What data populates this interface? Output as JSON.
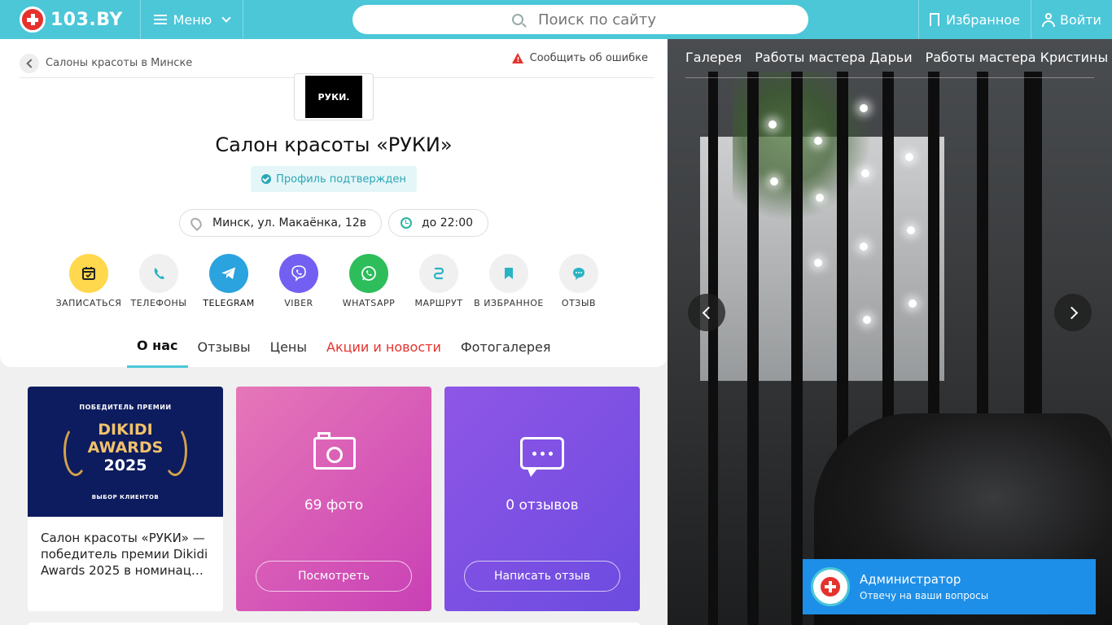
{
  "header": {
    "logo_text": "103.BY",
    "menu_label": "Меню",
    "search_placeholder": "Поиск по сайту",
    "favorites_label": "Избранное",
    "login_label": "Войти"
  },
  "breadcrumb": {
    "label": "Салоны красоты в Минске"
  },
  "report_label": "Сообщить об ошибке",
  "salon": {
    "logo_text": "РУКИ.",
    "title": "Салон красоты «РУКИ»",
    "verified": "Профиль подтвержден",
    "address": "Минск, ул. Макаёнка, 12в",
    "hours": "до 22:00"
  },
  "actions": [
    {
      "label": "ЗАПИСАТЬСЯ",
      "icon": "calendar-icon",
      "color": "#ffd84d"
    },
    {
      "label": "ТЕЛЕФОНЫ",
      "icon": "phone-icon",
      "color": "#f0f0f0"
    },
    {
      "label": "TELEGRAM",
      "icon": "telegram-icon",
      "color": "#2aa3df"
    },
    {
      "label": "VIBER",
      "icon": "viber-icon",
      "color": "#7360f2"
    },
    {
      "label": "WHATSAPP",
      "icon": "whatsapp-icon",
      "color": "#2dbd5b"
    },
    {
      "label": "МАРШРУТ",
      "icon": "route-icon",
      "color": "#f0f0f0"
    },
    {
      "label": "В ИЗБРАННОЕ",
      "icon": "bookmark-icon",
      "color": "#f0f0f0"
    },
    {
      "label": "ОТЗЫВ",
      "icon": "review-icon",
      "color": "#f0f0f0"
    }
  ],
  "tabs": [
    {
      "label": "О нас"
    },
    {
      "label": "Отзывы"
    },
    {
      "label": "Цены"
    },
    {
      "label": "Акции и новости"
    },
    {
      "label": "Фотогалерея"
    }
  ],
  "award": {
    "top": "ПОБЕДИТЕЛЬ ПРЕМИИ",
    "line1": "DIKIDI",
    "line2": "AWARDS",
    "line3": "2025",
    "bottom": "ВЫБОР КЛИЕНТОВ",
    "text_line1": "Салон красоты «РУКИ» —",
    "text_line2": "победитель премии Dikidi",
    "text_line3": "Awards 2025 в номинац…"
  },
  "photos": {
    "count": "69 фото",
    "button": "Посмотреть"
  },
  "reviews": {
    "count": "0 отзывов",
    "button": "Написать отзыв"
  },
  "gallery": {
    "tabs": [
      {
        "label": "Галерея"
      },
      {
        "label": "Работы мастера Дарьи"
      },
      {
        "label": "Работы мастера Кристины"
      }
    ]
  },
  "chat": {
    "name": "Администратор",
    "subtitle": "Отвечу на ваши вопросы"
  },
  "colors": {
    "brand": "#4bc7d8",
    "accent_red": "#e5322d",
    "chat": "#1e8fe8"
  }
}
